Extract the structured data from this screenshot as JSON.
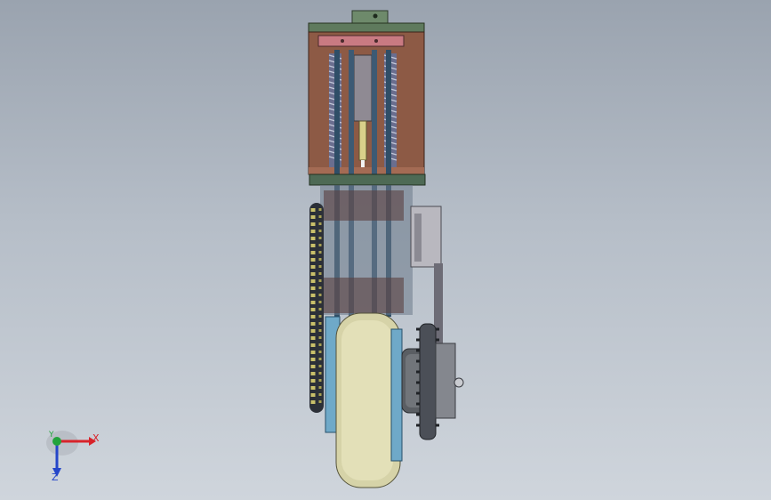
{
  "viewport": {
    "background_top": "#9aa3af",
    "background_bottom": "#cfd5dc"
  },
  "model": {
    "part_colors": {
      "housing": "#8d5a45",
      "spring": "#7a6f9a",
      "rod": "#3d5a74",
      "wheel": "#d6d3a8",
      "hub": "#6fa9c8",
      "sprocket": "#4b4f57",
      "chain": "#c9c06a",
      "plate": "#b9b8bf"
    }
  },
  "triad": {
    "x_label": "X",
    "y_label": "Y",
    "z_label": "Z",
    "x_color": "#d8232a",
    "y_color": "#22a33b",
    "z_color": "#2546c9"
  }
}
